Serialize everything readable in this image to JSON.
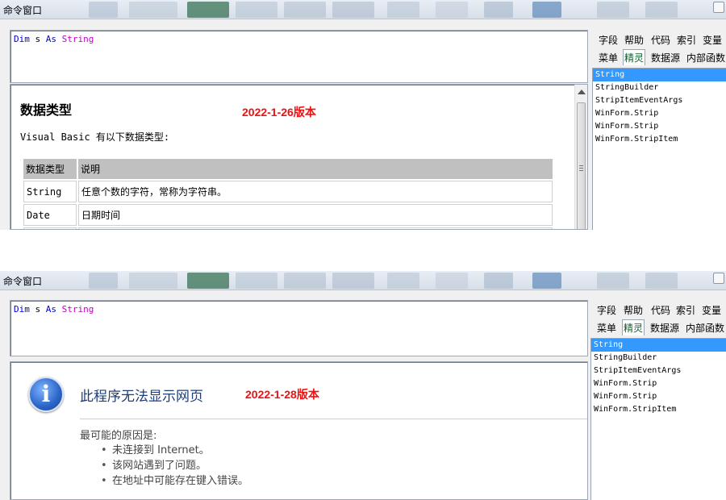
{
  "window": {
    "title": "命令窗口"
  },
  "code": {
    "keyword": "Dim",
    "identifier": "s",
    "as": "As",
    "type": "String"
  },
  "tabs": {
    "row1": [
      "字段",
      "帮助",
      "代码",
      "索引",
      "变量"
    ],
    "row2": [
      "菜单",
      "精灵",
      "数据源",
      "内部函数"
    ],
    "active": "精灵"
  },
  "suggestions": [
    "String",
    "StringBuilder",
    "StripItemEventArgs",
    "WinForm.Strip",
    "WinForm.Strip",
    "WinForm.StripItem"
  ],
  "top_panel": {
    "doc_title": "数据类型",
    "version": "2022-1-26版本",
    "intro": "Visual Basic 有以下数据类型:",
    "table": {
      "headers": [
        "数据类型",
        "说明"
      ],
      "rows": [
        [
          "String",
          "任意个数的字符，常称为字符串。"
        ],
        [
          "Date",
          "日期时间"
        ],
        [
          "",
          ""
        ]
      ]
    }
  },
  "bottom_panel": {
    "error_title": "此程序无法显示网页",
    "version": "2022-1-28版本",
    "reason_heading": "最可能的原因是:",
    "reasons": [
      "未连接到 Internet。",
      "该网站遇到了问题。",
      "在地址中可能存在键入错误。"
    ]
  },
  "colors": {
    "version_red": "#ee1111",
    "selection": "#3399ff",
    "keyword": "#0000cc",
    "type": "#c000c0"
  }
}
